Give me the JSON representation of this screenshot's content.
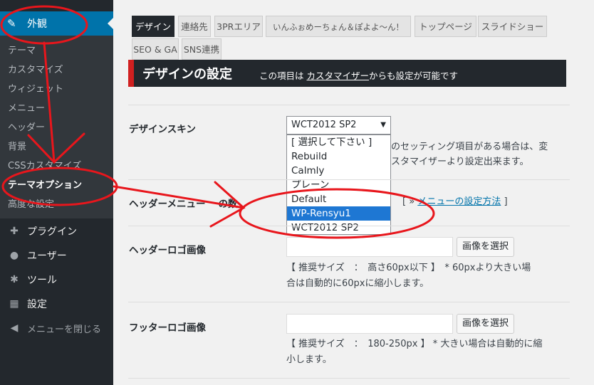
{
  "sidebar": {
    "active": {
      "label": "外観",
      "icon": "paintbrush-icon"
    },
    "submenu": [
      "テーマ",
      "カスタマイズ",
      "ウィジェット",
      "メニュー",
      "ヘッダー",
      "背景",
      "CSSカスタマイズ",
      "テーマオプション",
      "高度な設定"
    ],
    "current_sub": "テーマオプション",
    "menu": [
      {
        "label": "プラグイン",
        "icon": "plugin-icon"
      },
      {
        "label": "ユーザー",
        "icon": "user-icon"
      },
      {
        "label": "ツール",
        "icon": "wrench-icon"
      },
      {
        "label": "設定",
        "icon": "settings-icon"
      }
    ],
    "collapse": {
      "label": "メニューを閉じる",
      "icon": "collapse-icon"
    }
  },
  "tabs": [
    "デザイン",
    "連絡先",
    "3PRエリア",
    "いんふぉめーちょん＆ぽよよ～ん！",
    "トップページ",
    "スライドショー",
    "SEO & GA",
    "SNS連携"
  ],
  "banner": {
    "title": "デザインの設定",
    "note_prefix": "この項目は",
    "note_link": "カスタマイザー",
    "note_suffix": "からも設定が可能です"
  },
  "design_skin": {
    "label": "デザインスキン",
    "selected": "WCT2012 SP2",
    "options": [
      "[ 選択して下さい ]",
      "Rebuild",
      "Calmly",
      "プレーン",
      "Default",
      "WP-Rensyu1",
      "WCT2012 SP2"
    ],
    "highlighted": "WP-Rensyu1",
    "desc_line1": "のセッティング項目がある場合は、変",
    "desc_line2": "スタマイザーより設定出来ます。"
  },
  "header_menu": {
    "label": "ヘッダーメニュー",
    "label_tail": "の数",
    "link": "メニューの設定方法",
    "link_prefix": "[ »",
    "link_suffix": "]"
  },
  "header_logo": {
    "label": "ヘッダーロゴ画像",
    "button": "画像を選択",
    "desc_line1": "【 推奨サイズ　：　高さ60px以下 】　* 60pxより大きい場",
    "desc_line2": "合は自動的に60pxに縮小します。"
  },
  "footer_logo": {
    "label": "フッターロゴ画像",
    "button": "画像を選択",
    "desc_line1": "【 推奨サイズ　：　180-250px 】 * 大きい場合は自動的に縮",
    "desc_line2": "小します。"
  },
  "colors": {
    "accent": "#0073aa",
    "annotation": "#e8161c",
    "sidebar": "#23282d",
    "highlight": "#1e77d3"
  }
}
